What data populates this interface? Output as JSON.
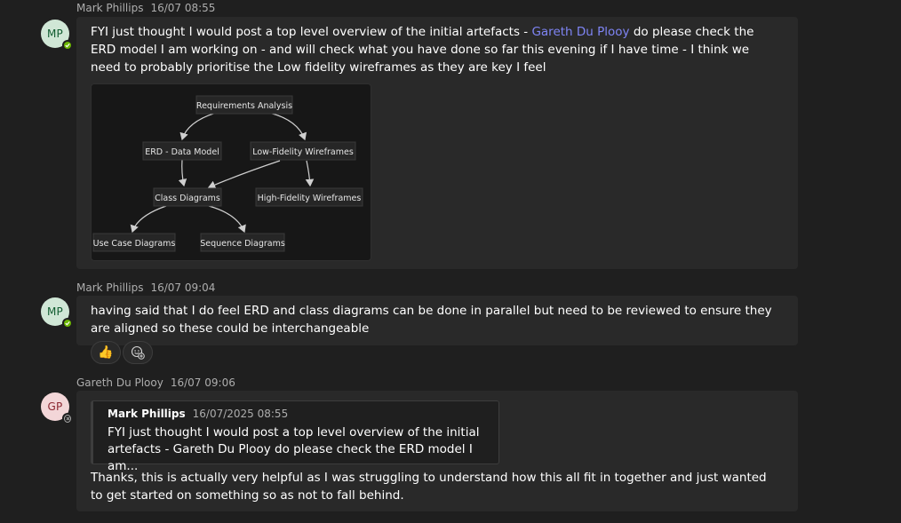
{
  "messages": [
    {
      "author": "Mark Phillips",
      "time": "16/07 08:55",
      "avatar_initials": "MP",
      "presence": "available",
      "text_before_mention": "FYI just  thought I would post a top level overview of the initial artefacts  - ",
      "mention": "Gareth Du Plooy",
      "text_after_mention": " do please check the ERD model I am working on - and will check what you have done so far this evening  if I have time - I think we need to probably prioritise the Low fidelity wireframes as they are key I feel",
      "diagram": {
        "nodes": {
          "requirements": "Requirements Analysis",
          "erd": "ERD - Data Model",
          "lofi": "Low-Fidelity Wireframes",
          "class": "Class Diagrams",
          "hifi": "High-Fidelity Wireframes",
          "usecase": "Use Case Diagrams",
          "sequence": "Sequence Diagrams"
        }
      }
    },
    {
      "author": "Mark Phillips",
      "time": "16/07 09:04",
      "avatar_initials": "MP",
      "presence": "available",
      "text": "having said that I do feel ERD and class diagrams can be done in parallel but need to be reviewed to ensure they are aligned so these could be interchangeable",
      "reactions": [
        {
          "icon": "thumbs-up-icon",
          "emoji": "👍"
        },
        {
          "icon": "add-reaction-icon"
        }
      ]
    },
    {
      "author": "Gareth Du Plooy",
      "time": "16/07 09:06",
      "avatar_initials": "GP",
      "presence": "offline",
      "quote": {
        "author": "Mark Phillips",
        "time": "16/07/2025 08:55",
        "text": "FYI just thought I would post a top level overview of the initial artefacts - Gareth Du Plooy do please check the ERD model I am..."
      },
      "text": "Thanks, this is actually very helpful as I was struggling to understand how this all fit in together and just wanted to get started on something so as not to fall behind."
    }
  ],
  "colors": {
    "background": "#1f1f1f",
    "bubble": "#292929",
    "mention": "#7f85f5",
    "presence_available": "#6bb700"
  }
}
